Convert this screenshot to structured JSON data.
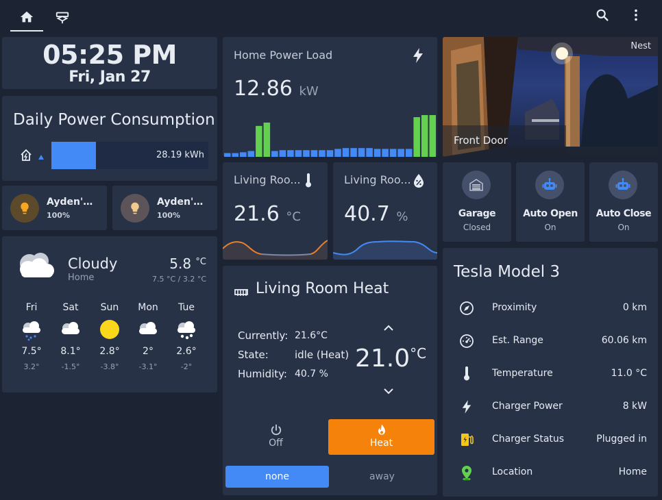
{
  "colors": {
    "background": "#1c2333",
    "card": "#283247",
    "accent_blue": "#448af7",
    "accent_orange": "#f5830b",
    "green": "#63d14f"
  },
  "clock": {
    "time": "05:25 PM",
    "date": "Fri, Jan 27"
  },
  "power_consumption": {
    "title": "Daily Power Consumption",
    "value": "28.19 kWh",
    "icon": "home-lightning-icon"
  },
  "lights": [
    {
      "name": "Ayden's Li...",
      "state": "100%",
      "icon": "bulb-icon",
      "on": true
    },
    {
      "name": "Ayden's D...",
      "state": "100%",
      "icon": "bulb-icon",
      "on": false
    }
  ],
  "weather": {
    "condition": "Cloudy",
    "location": "Home",
    "temp": "5.8",
    "unit": "°C",
    "range": "7.5 °C / 3.2 °C",
    "forecast": [
      {
        "day": "Fri",
        "hi": "7.5°",
        "lo": "3.2°",
        "icon": "rain-cloud-icon"
      },
      {
        "day": "Sat",
        "hi": "8.1°",
        "lo": "-1.5°",
        "icon": "cloud-icon"
      },
      {
        "day": "Sun",
        "hi": "2.8°",
        "lo": "-3.8°",
        "icon": "sun-icon"
      },
      {
        "day": "Mon",
        "hi": "2°",
        "lo": "-3.1°",
        "icon": "cloud-icon"
      },
      {
        "day": "Tue",
        "hi": "2.6°",
        "lo": "-2°",
        "icon": "snow-cloud-icon"
      }
    ]
  },
  "power_load": {
    "title": "Home Power Load",
    "value": "12.86",
    "unit": "kW",
    "icon": "lightning-icon",
    "bars": [
      {
        "level": 0.09,
        "high": false
      },
      {
        "level": 0.09,
        "high": false
      },
      {
        "level": 0.11,
        "high": false
      },
      {
        "level": 0.14,
        "high": false
      },
      {
        "level": 0.74,
        "high": true
      },
      {
        "level": 0.82,
        "high": true
      },
      {
        "level": 0.14,
        "high": false
      },
      {
        "level": 0.16,
        "high": false
      },
      {
        "level": 0.16,
        "high": false
      },
      {
        "level": 0.16,
        "high": false
      },
      {
        "level": 0.16,
        "high": false
      },
      {
        "level": 0.16,
        "high": false
      },
      {
        "level": 0.16,
        "high": false
      },
      {
        "level": 0.16,
        "high": false
      },
      {
        "level": 0.19,
        "high": false
      },
      {
        "level": 0.21,
        "high": false
      },
      {
        "level": 0.21,
        "high": false
      },
      {
        "level": 0.21,
        "high": false
      },
      {
        "level": 0.21,
        "high": false
      },
      {
        "level": 0.19,
        "high": false
      },
      {
        "level": 0.19,
        "high": false
      },
      {
        "level": 0.19,
        "high": false
      },
      {
        "level": 0.19,
        "high": false
      },
      {
        "level": 0.19,
        "high": false
      },
      {
        "level": 0.95,
        "high": true
      },
      {
        "level": 1.0,
        "high": true
      },
      {
        "level": 1.0,
        "high": true
      }
    ]
  },
  "sensor_temp": {
    "title": "Living Roo...",
    "value": "21.6",
    "unit": "°C",
    "icon": "thermometer-icon"
  },
  "sensor_humidity": {
    "title": "Living Roo...",
    "value": "40.7",
    "unit": "%",
    "icon": "water-percent-icon"
  },
  "thermostat": {
    "title": "Living Room Heat",
    "icon": "radiator-icon",
    "labels": {
      "current": "Currently:",
      "state": "State:",
      "humidity": "Humidity:"
    },
    "values": {
      "current": "21.6°C",
      "state": "idle (Heat)",
      "humidity": "40.7 %"
    },
    "target": "21.0",
    "target_unit": "°C",
    "modes": [
      {
        "label": "Off",
        "icon": "power-icon",
        "active": false
      },
      {
        "label": "Heat",
        "icon": "flame-icon",
        "active": true
      }
    ],
    "presets": [
      {
        "label": "none",
        "active": true
      },
      {
        "label": "away",
        "active": false
      }
    ]
  },
  "camera": {
    "name": "Front Door",
    "brand": "Nest"
  },
  "garage_buttons": [
    {
      "name": "Garage",
      "state": "Closed",
      "icon": "garage-icon"
    },
    {
      "name": "Auto Open",
      "state": "On",
      "icon": "robot-icon"
    },
    {
      "name": "Auto Close",
      "state": "On",
      "icon": "robot-icon"
    }
  ],
  "tesla": {
    "title": "Tesla Model 3",
    "rows": [
      {
        "label": "Proximity",
        "value": "0 km",
        "icon": "compass-icon"
      },
      {
        "label": "Est. Range",
        "value": "60.06 km",
        "icon": "gauge-icon"
      },
      {
        "label": "Temperature",
        "value": "11.0 °C",
        "icon": "thermometer-icon"
      },
      {
        "label": "Charger Power",
        "value": "8 kW",
        "icon": "lightning-icon"
      },
      {
        "label": "Charger Status",
        "value": "Plugged in",
        "icon": "ev-station-icon"
      },
      {
        "label": "Location",
        "value": "Home",
        "icon": "map-marker-icon"
      }
    ]
  }
}
